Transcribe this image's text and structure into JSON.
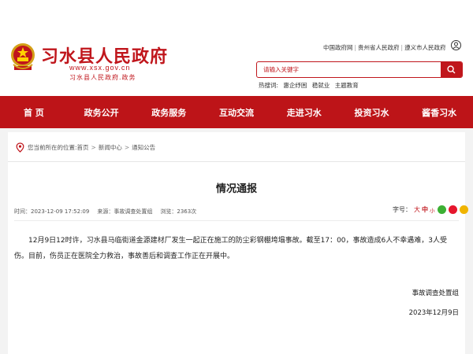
{
  "header": {
    "title": "习水县人民政府",
    "url": "www.xsx.gov.cn",
    "subtitle": "习水县人民政府.政务",
    "top_links": [
      "中国政府网",
      "贵州省人民政府",
      "遵义市人民政府"
    ],
    "search": {
      "placeholder": "请输入关键字"
    },
    "hot_search": {
      "label": "热搜词:",
      "words": [
        "惠企纾困",
        "稳就业",
        "主题教育"
      ]
    }
  },
  "nav": {
    "items": [
      "首 页",
      "政务公开",
      "政务服务",
      "互动交流",
      "走进习水",
      "投资习水",
      "酱香习水"
    ]
  },
  "breadcrumb": {
    "label": "您当前所在的位置:",
    "items": [
      "首页",
      "新闻中心",
      "通知公告"
    ],
    "separator": ">"
  },
  "article": {
    "title": "情况通报",
    "time": "时间：2023-12-09 17:52:09",
    "source": "来源：事故调查处置组",
    "views": "浏览：2363次",
    "font_size": {
      "label": "字号：",
      "big": "大",
      "medium": "中",
      "small": "小"
    },
    "body": "12月9日12时许，习水县马临街道金源建材厂发生一起正在施工的防尘彩钢棚垮塌事故。截至17：00，事故造成6人不幸遇难，3人受伤。目前，伤员正在医院全力救治，事故善后和调查工作正在开展中。",
    "signature": "事故调查处置组",
    "date": "2023年12月9日"
  },
  "colors": {
    "brand_red": "#c0161c",
    "nav_red": "#bd1418"
  },
  "icons": [
    "national-emblem-icon",
    "user-icon",
    "search-icon",
    "location-icon",
    "wechat-share-icon",
    "weibo-share-icon",
    "qzone-share-icon"
  ]
}
